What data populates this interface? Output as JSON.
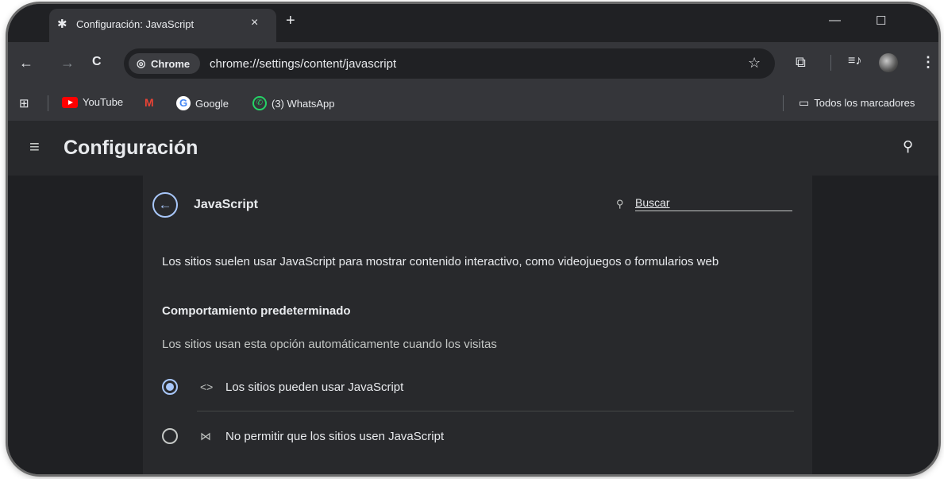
{
  "tab": {
    "title": "Configuración: JavaScript",
    "close": "×",
    "new_tab": "+"
  },
  "window_controls": {
    "minimize": "—",
    "maximize": "☐"
  },
  "toolbar": {
    "back": "←",
    "forward": "→",
    "reload": "C",
    "chip_label": "Chrome",
    "url": "chrome://settings/content/javascript",
    "bookmark_star": "☆"
  },
  "bookmarks": {
    "items": [
      "YouTube",
      "Google",
      "(3) WhatsApp"
    ],
    "all_bookmarks": "Todos los marcadores"
  },
  "settings": {
    "title": "Configuración",
    "page_title": "JavaScript",
    "search_placeholder": "Buscar",
    "description": "Los sitios suelen usar JavaScript para mostrar contenido interactivo, como videojuegos o formularios web",
    "default_behavior": "Comportamiento predeterminado",
    "default_behavior_sub": "Los sitios usan esta opción automáticamente cuando los visitas",
    "options": [
      {
        "label": "Los sitios pueden usar JavaScript",
        "icon": "<>",
        "selected": true
      },
      {
        "label": "No permitir que los sitios usen JavaScript",
        "icon": "⋈",
        "selected": false
      }
    ]
  },
  "colors": {
    "accent": "#a8c7fa",
    "background": "#1f2023",
    "card": "#28292c"
  }
}
